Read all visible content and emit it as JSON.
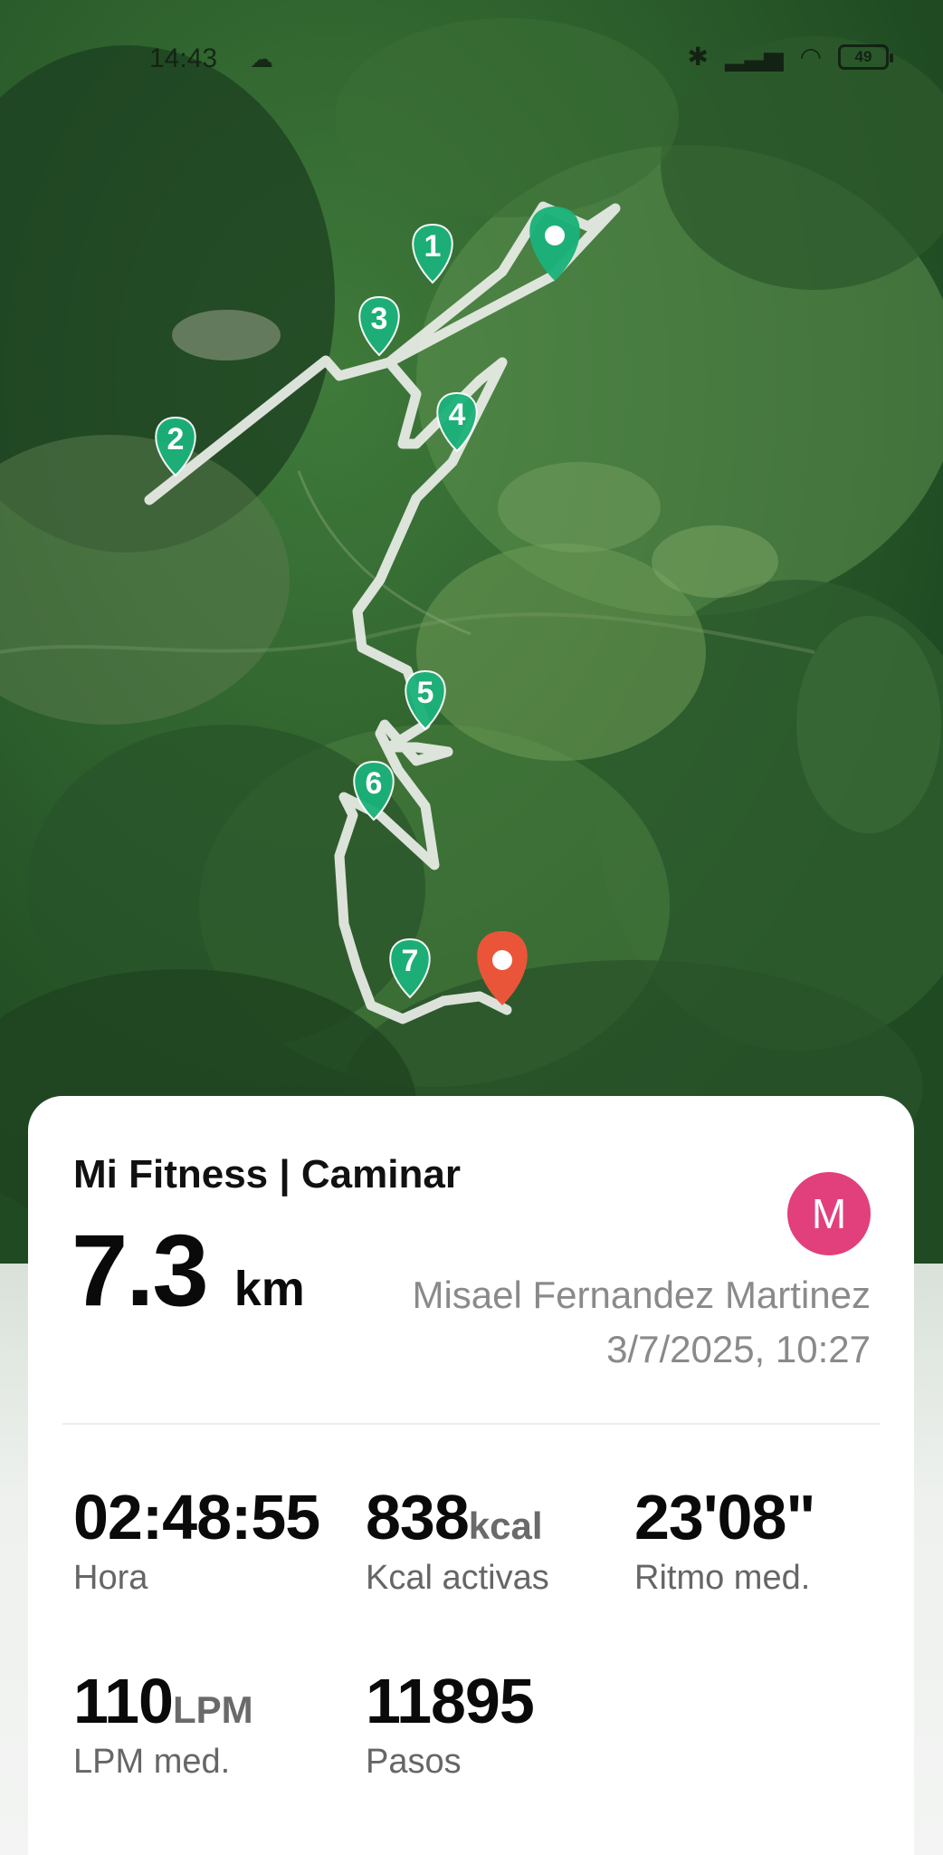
{
  "status_bar": {
    "time": "14:43",
    "battery": "49",
    "cloud_icon": "cloud-icon",
    "bluetooth_icon": "bluetooth-icon",
    "signal_icon": "signal-icon",
    "wifi_icon": "wifi-icon"
  },
  "map": {
    "waypoints": [
      "1",
      "2",
      "3",
      "4",
      "5",
      "6",
      "7"
    ],
    "start_marker": "start-pin-icon",
    "end_marker": "end-pin-icon",
    "colors": {
      "route": "#e8ece6",
      "waypoint": "#1bb27a",
      "start": "#1bb27a",
      "end": "#f0553a"
    }
  },
  "card": {
    "app_title": "Mi Fitness | Caminar",
    "distance_value": "7.3",
    "distance_unit": "km",
    "avatar_letter": "M",
    "user_name": "Misael Fernandez Martinez",
    "datetime": "3/7/2025, 10:27",
    "stats": {
      "time": {
        "value": "02:48:55",
        "unit": "",
        "label": "Hora"
      },
      "kcal": {
        "value": "838",
        "unit": "kcal",
        "label": "Kcal activas"
      },
      "pace": {
        "value": "23'08\"",
        "unit": "",
        "label": "Ritmo med."
      },
      "bpm": {
        "value": "110",
        "unit": "LPM",
        "label": "LPM med."
      },
      "steps": {
        "value": "11895",
        "unit": "",
        "label": "Pasos"
      }
    },
    "colors": {
      "avatar": "#e1407c"
    }
  }
}
